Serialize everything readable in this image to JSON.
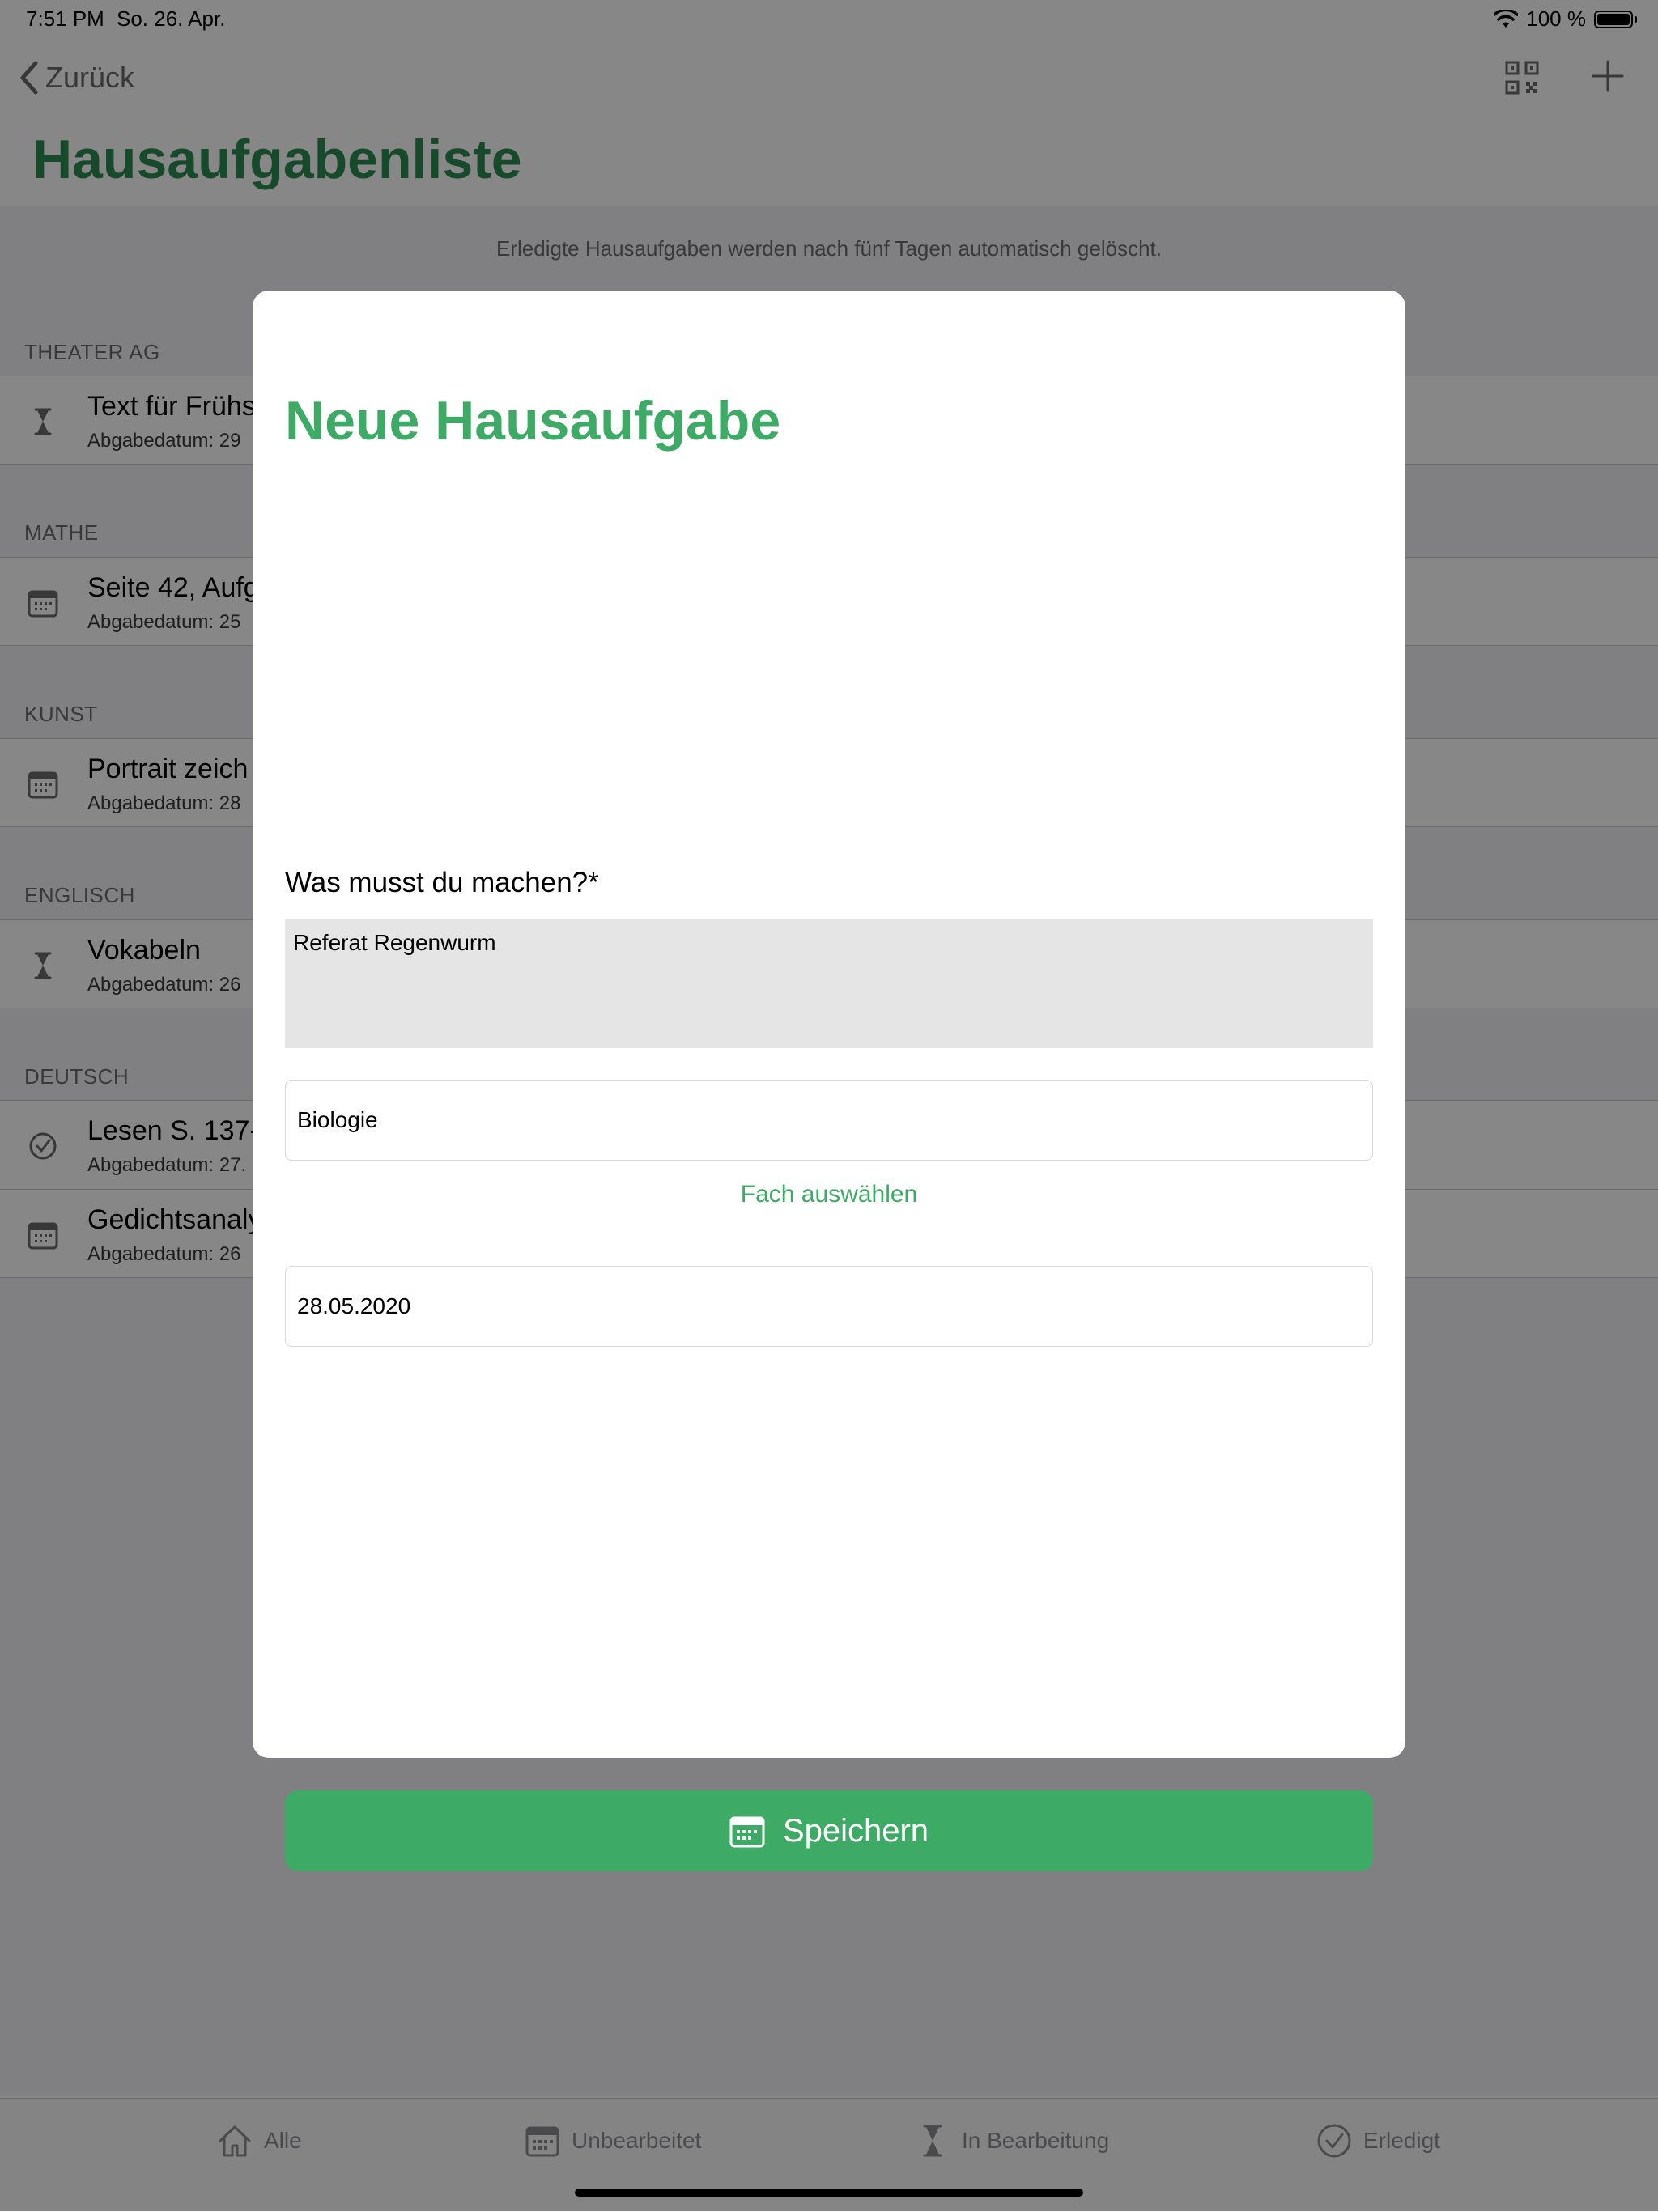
{
  "status_bar": {
    "time": "7:51 PM",
    "date": "So. 26. Apr.",
    "battery": "100 %"
  },
  "nav": {
    "back_label": "Zurück",
    "title": "Hausaufgabenliste",
    "icons": [
      "qr-code-icon",
      "plus-icon"
    ]
  },
  "hint": "Erledigte Hausaufgaben werden nach fünf Tagen automatisch gelöscht.",
  "sections": [
    {
      "label": "THEATER AG",
      "items": [
        {
          "title": "Text für Frühs",
          "sub": "Abgabedatum: 29",
          "icon": "hourglass-icon"
        }
      ]
    },
    {
      "label": "MATHE",
      "items": [
        {
          "title": "Seite 42, Aufg",
          "sub": "Abgabedatum: 25",
          "icon": "calendar-icon"
        }
      ]
    },
    {
      "label": "KUNST",
      "items": [
        {
          "title": "Portrait zeich",
          "sub": "Abgabedatum: 28",
          "icon": "calendar-icon"
        }
      ]
    },
    {
      "label": "ENGLISCH",
      "items": [
        {
          "title": "Vokabeln",
          "sub": "Abgabedatum: 26",
          "icon": "hourglass-icon"
        }
      ]
    },
    {
      "label": "DEUTSCH",
      "items": [
        {
          "title": "Lesen S. 137-",
          "sub": "Abgabedatum: 27.",
          "icon": "checkmark-circle-icon"
        },
        {
          "title": "Gedichtsanaly",
          "sub": "Abgabedatum: 26",
          "icon": "calendar-icon"
        }
      ]
    }
  ],
  "tabs": [
    {
      "label": "Alle",
      "icon": "home-icon"
    },
    {
      "label": "Unbearbeitet",
      "icon": "calendar-icon"
    },
    {
      "label": "In Bearbeitung",
      "icon": "hourglass-icon"
    },
    {
      "label": "Erledigt",
      "icon": "checkmark-circle-icon"
    }
  ],
  "modal": {
    "title": "Neue Hausaufgabe",
    "question_label": "Was musst du machen?*",
    "task_text": "Referat Regenwurm",
    "subject_value": "Biologie",
    "subject_link": "Fach auswählen",
    "date_value": "28.05.2020",
    "save_label": "Speichern"
  },
  "colors": {
    "accent": "#3dab65",
    "title_green": "#2d8a52"
  }
}
